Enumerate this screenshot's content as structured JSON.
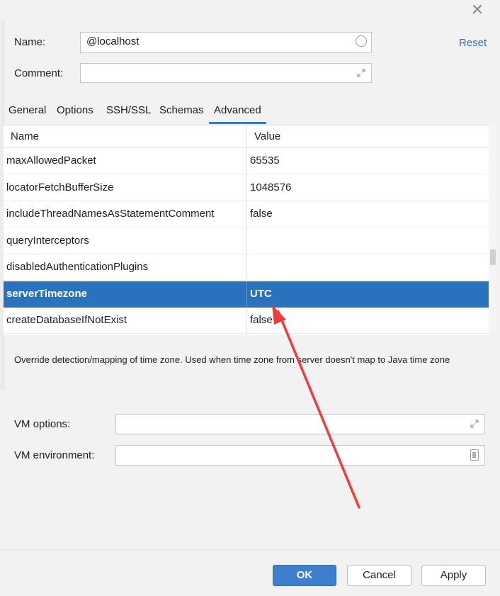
{
  "dialog": {
    "name_label": "Name:",
    "name_value": "@localhost",
    "reset_label": "Reset",
    "comment_label": "Comment:",
    "comment_value": ""
  },
  "tabs": [
    {
      "label": "General",
      "active": false
    },
    {
      "label": "Options",
      "active": false
    },
    {
      "label": "SSH/SSL",
      "active": false
    },
    {
      "label": "Schemas",
      "active": false
    },
    {
      "label": "Advanced",
      "active": true
    }
  ],
  "table": {
    "headers": {
      "name": "Name",
      "value": "Value"
    },
    "rows": [
      {
        "name": "maxAllowedPacket",
        "value": "65535"
      },
      {
        "name": "locatorFetchBufferSize",
        "value": "1048576"
      },
      {
        "name": "includeThreadNamesAsStatementComment",
        "value": "false"
      },
      {
        "name": "queryInterceptors",
        "value": ""
      },
      {
        "name": "disabledAuthenticationPlugins",
        "value": ""
      },
      {
        "name": "serverTimezone",
        "value": "UTC",
        "selected": true
      },
      {
        "name": "createDatabaseIfNotExist",
        "value": "false"
      }
    ]
  },
  "description": "Override detection/mapping of time zone. Used when time zone from server doesn't map to Java time zone",
  "vm": {
    "options_label": "VM options:",
    "options_value": "",
    "environment_label": "VM environment:",
    "environment_value": ""
  },
  "buttons": {
    "ok": "OK",
    "cancel": "Cancel",
    "apply": "Apply"
  },
  "colors": {
    "selection": "#2b72bd",
    "accent_link": "#2f6fb3",
    "annotation_arrow": "#f23c3c"
  },
  "icons": [
    "close-icon",
    "circle-icon",
    "expand-icon",
    "document-icon"
  ]
}
